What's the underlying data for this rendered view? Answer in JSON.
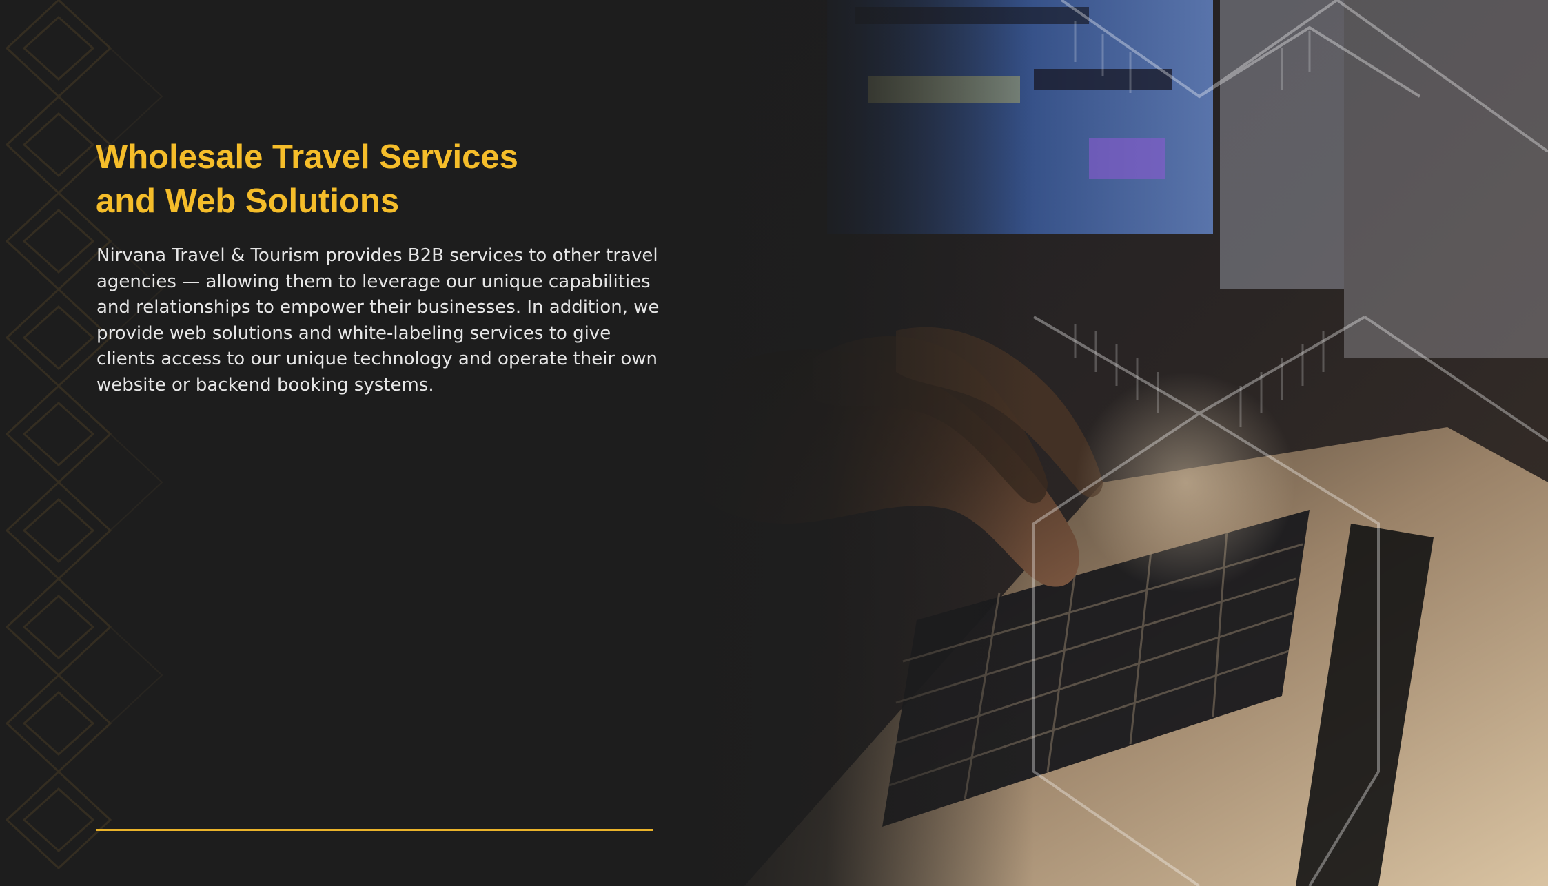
{
  "heading": {
    "line1": "Wholesale Travel Services",
    "line2": "and Web Solutions"
  },
  "body": {
    "paragraph": "Nirvana Travel & Tourism provides B2B services to other travel agencies — allowing them to leverage our unique capabilities and relationships to empower their businesses. In addition, we provide web solutions and white-labeling services to give clients access to our unique technology and operate their own website or backend booking systems."
  },
  "colors": {
    "background": "#1d1d1d",
    "accent": "#f5bd2a",
    "body_text": "#e6e6e6"
  },
  "images": {
    "photo": "hands-typing-on-laptop-keyboard",
    "pattern": "geometric-diamond-pattern"
  }
}
